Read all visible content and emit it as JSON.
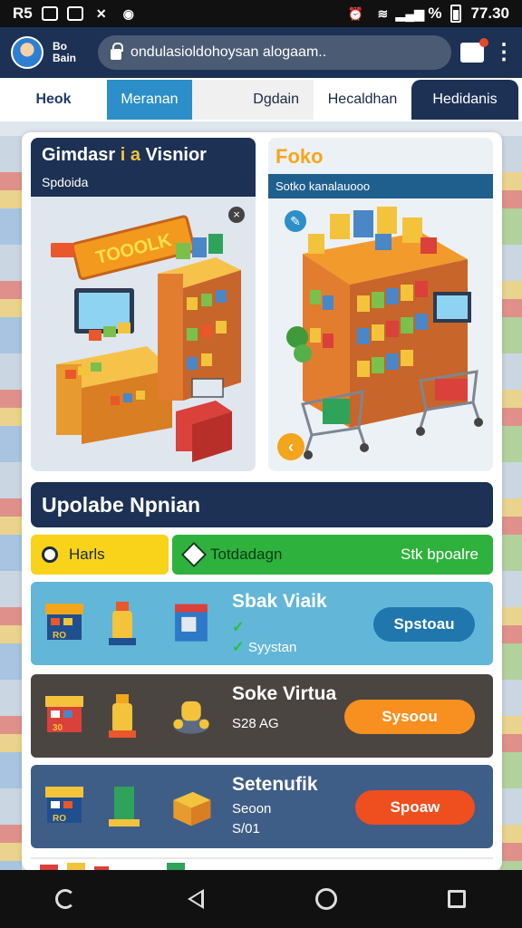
{
  "status_bar": {
    "left_text": "R5",
    "time": "77.30",
    "signal_text": "%"
  },
  "browser": {
    "profile_name": "Bo Bain",
    "url": "ondulasioldohoysan alogaam.."
  },
  "tabs": [
    {
      "label": "Heok"
    },
    {
      "label": "Meranan"
    },
    {
      "label": "Dgdain"
    },
    {
      "label": "Hecaldhan"
    },
    {
      "label": "Hedidanis"
    }
  ],
  "cards": {
    "left": {
      "title_white": "Gimdasr",
      "title_accent": "i a",
      "title_rest": "Visnior",
      "subtitle": "Spdoida",
      "sign_text": "TOOOLK"
    },
    "right": {
      "title": "Foko",
      "subtitle": "Sotko kanalauooo"
    }
  },
  "section": {
    "title": "Upolabe Npnian"
  },
  "filters": {
    "first": "Harls",
    "second": "Totdadagn",
    "third": "Stk bpoalre"
  },
  "items": [
    {
      "title": "Sbak Viaik",
      "line1": "",
      "line2": "Syystan",
      "button": "Spstoau",
      "badge": "RO"
    },
    {
      "title": "Soke Virtua",
      "line1": "S28 AG",
      "button": "Sysoou",
      "badge": "30"
    },
    {
      "title": "Setenufik",
      "line1": "Seoon",
      "line2": "S/01",
      "button": "Spoaw",
      "badge": "RO"
    }
  ],
  "colors": {
    "navy": "#1c3154",
    "accent_blue": "#2d8fc9",
    "yellow": "#f9d21a",
    "green": "#2fb13e",
    "orange": "#f7901e",
    "red_orange": "#ef4e1f"
  }
}
